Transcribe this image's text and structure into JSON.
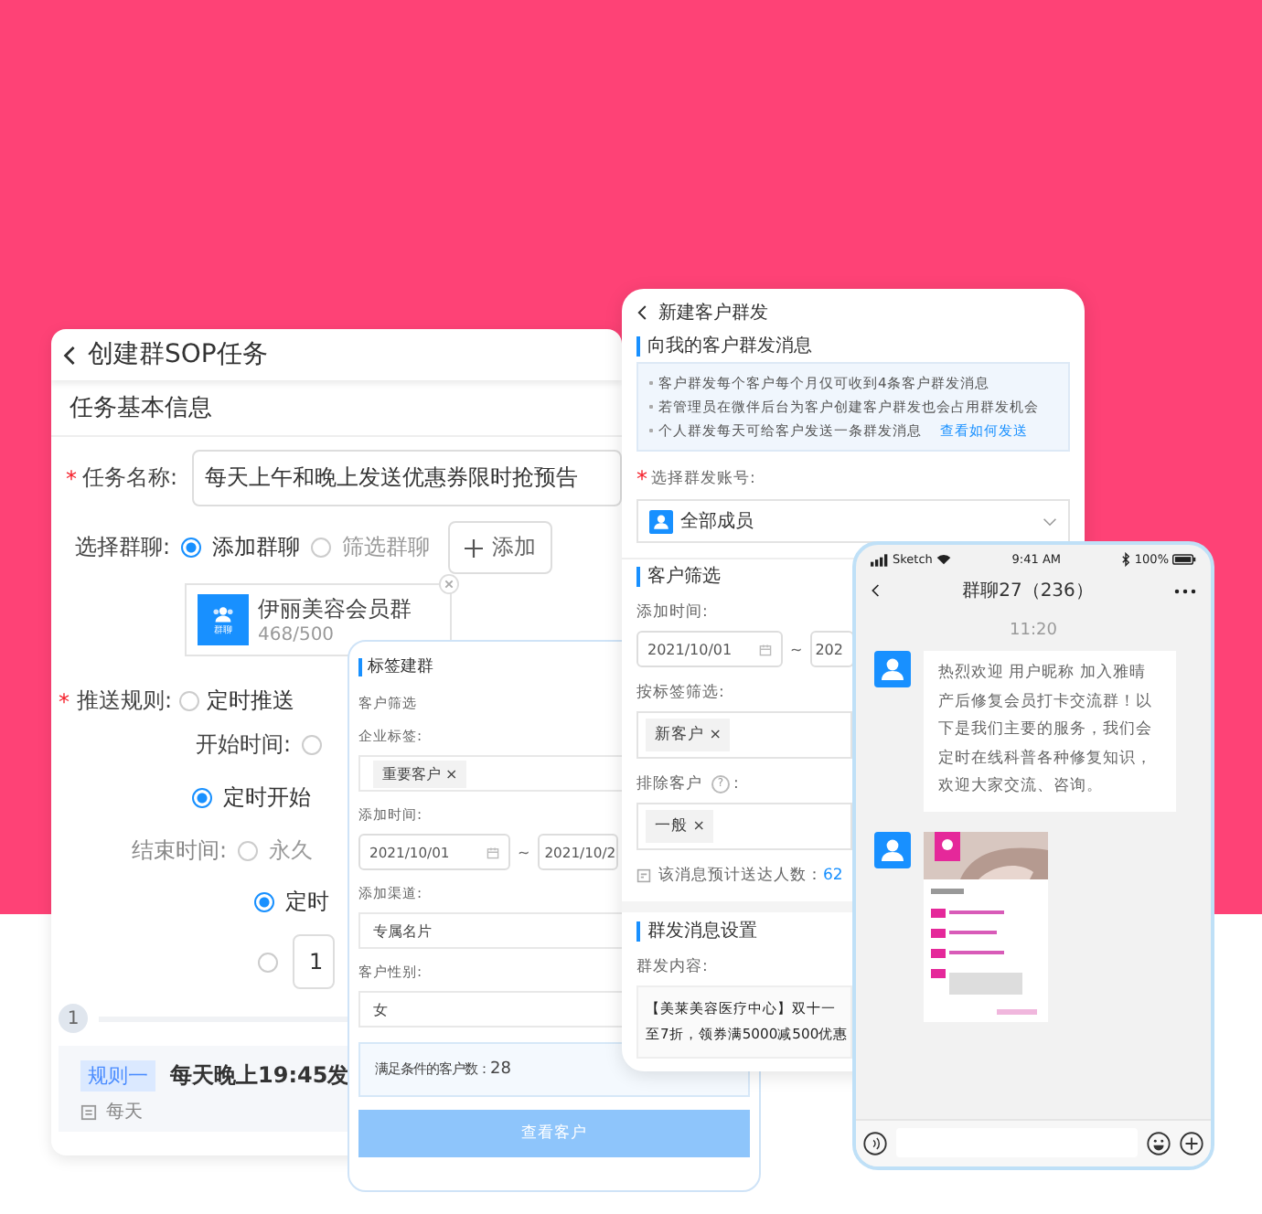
{
  "sop_window": {
    "title": "创建群SOP任务",
    "section": "任务基本信息",
    "task_name": {
      "mark": "*",
      "label": "任务名称:",
      "value": "每天上午和晚上发送优惠券限时抢预告"
    },
    "group_select": {
      "label": "选择群聊:",
      "options": [
        {
          "label": "添加群聊",
          "selected": true
        },
        {
          "label": "筛选群聊",
          "selected": false
        }
      ],
      "add_button": "添加"
    },
    "group_card": {
      "name": "伊丽美容会员群",
      "count": "468/500",
      "icon_label": "群聊"
    },
    "push_rule": {
      "mark": "*",
      "label": "推送规则:",
      "options": [
        {
          "label": "定时推送",
          "selected": false
        }
      ]
    },
    "start_time": {
      "label": "开始时间:",
      "options": [
        {
          "selected": false
        },
        {
          "label": "定时开始",
          "selected": true
        }
      ]
    },
    "end_time": {
      "label": "结束时间:",
      "options": [
        {
          "label": "永久",
          "selected": false
        },
        {
          "label": "定时",
          "selected": true
        },
        {
          "value": "1",
          "selected": false
        }
      ]
    },
    "step": "1",
    "rule": {
      "tag": "规则一",
      "title": "每天晚上19:45发",
      "frequency": "每天"
    }
  },
  "broadcast_window": {
    "title": "新建客户群发",
    "section": "向我的客户群发消息",
    "notes": [
      "客户群发每个客户每个月仅可收到4条客户群发消息",
      "若管理员在微伴后台为客户创建客户群发也会占用群发机会",
      "个人群发每天可给客户发送一条群发消息"
    ],
    "notes_link": "查看如何发送",
    "account": {
      "mark": "*",
      "label": "选择群发账号:",
      "value": "全部成员"
    },
    "filter_section": "客户筛选",
    "add_time": {
      "label": "添加时间:",
      "from": "2021/10/01",
      "separator": "~",
      "to": "202"
    },
    "tag_filter": {
      "label": "按标签筛选:",
      "tags": [
        {
          "label": "新客户",
          "remove": "×"
        }
      ]
    },
    "exclude": {
      "label": "排除客户",
      "help": "?",
      "suffix": ":",
      "tags": [
        {
          "label": "一般",
          "remove": "×"
        }
      ]
    },
    "estimate": {
      "label": "该消息预计送达人数：",
      "value": "62"
    },
    "message_section": "群发消息设置",
    "content": {
      "label": "群发内容:",
      "lines": [
        "【美莱美容医疗中心】双十一",
        "至7折，领券满5000减500优惠"
      ]
    }
  },
  "tag_group_window": {
    "title": "标签建群",
    "section": "客户筛选",
    "corp_tag": {
      "label": "企业标签:",
      "tags": [
        {
          "label": "重要客户",
          "remove": "×"
        }
      ]
    },
    "add_time": {
      "label": "添加时间:",
      "from": "2021/10/01",
      "separator": "~",
      "to": "2021/10/2"
    },
    "channel": {
      "label": "添加渠道:",
      "value": "专属名片"
    },
    "gender": {
      "label": "客户性别:",
      "value": "女"
    },
    "matched": {
      "label": "满足条件的客户数：",
      "value": "28"
    },
    "button": "查看客户"
  },
  "phone": {
    "status": {
      "carrier": "Sketch",
      "time": "9:41 AM",
      "battery": "100%"
    },
    "title": "群聊27（236）",
    "timestamp": "11:20",
    "messages": [
      {
        "kind": "text",
        "text": "热烈欢迎 用户昵称 加入雅晴产后修复会员打卡交流群！以下是我们主要的服务，我们会定时在线科普各种修复知识，欢迎大家交流、咨询。"
      },
      {
        "kind": "picture"
      }
    ]
  }
}
